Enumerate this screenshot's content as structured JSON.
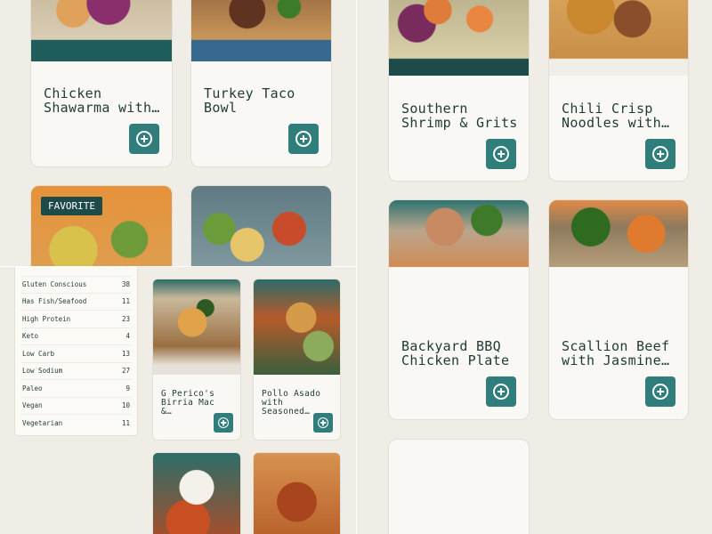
{
  "top_left_cards": [
    {
      "title": "Chicken\nShawarma with…"
    },
    {
      "title": "Turkey Taco\nBowl"
    }
  ],
  "favorite_badge": "FAVORITE",
  "right_cards": [
    {
      "title": "Southern\nShrimp & Grits"
    },
    {
      "title": "Chili Crisp\nNoodles with…"
    },
    {
      "title": "Backyard BBQ\nChicken Plate"
    },
    {
      "title": "Scallion Beef\nwith Jasmine…"
    }
  ],
  "filters": [
    {
      "label": "Gluten Conscious",
      "count": "38"
    },
    {
      "label": "Has Fish/Seafood",
      "count": "11"
    },
    {
      "label": "High Protein",
      "count": "23"
    },
    {
      "label": "Keto",
      "count": "4"
    },
    {
      "label": "Low Carb",
      "count": "13"
    },
    {
      "label": "Low Sodium",
      "count": "27"
    },
    {
      "label": "Paleo",
      "count": "9"
    },
    {
      "label": "Vegan",
      "count": "10"
    },
    {
      "label": "Vegetarian",
      "count": "11"
    }
  ],
  "small_cards": [
    {
      "title": "G Perico's\nBirria Mac &…"
    },
    {
      "title": "Pollo Asado\nwith Seasoned…"
    }
  ],
  "colors": {
    "accent": "#2f7e7b",
    "background": "#efede6",
    "card": "#f9f8f4",
    "text": "#1f3a37"
  },
  "icons": {
    "add": "plus-circle-icon"
  }
}
